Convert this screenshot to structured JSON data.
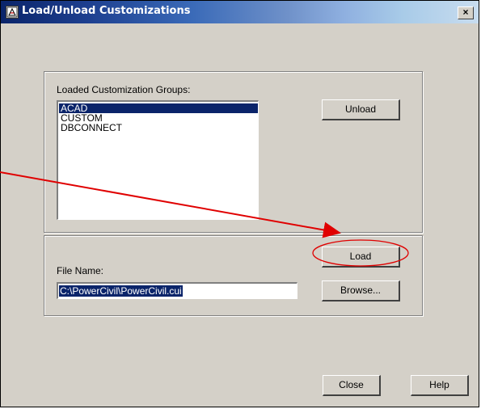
{
  "window": {
    "title": "Load/Unload Customizations",
    "close_glyph": "×"
  },
  "groups_box": {
    "label": "Loaded Customization Groups:",
    "items": [
      "ACAD",
      "CUSTOM",
      "DBCONNECT"
    ],
    "selected": "ACAD",
    "unload_label": "Unload"
  },
  "file_box": {
    "load_label": "Load",
    "file_name_label": "File Name:",
    "file_name_value": "C:\\PowerCivil\\PowerCivil.cui",
    "browse_label": "Browse..."
  },
  "footer": {
    "close_label": "Close",
    "help_label": "Help"
  },
  "colors": {
    "annotation": "#e00000",
    "selection": "#0a246a"
  },
  "icons": [
    "app-icon",
    "close-icon"
  ]
}
